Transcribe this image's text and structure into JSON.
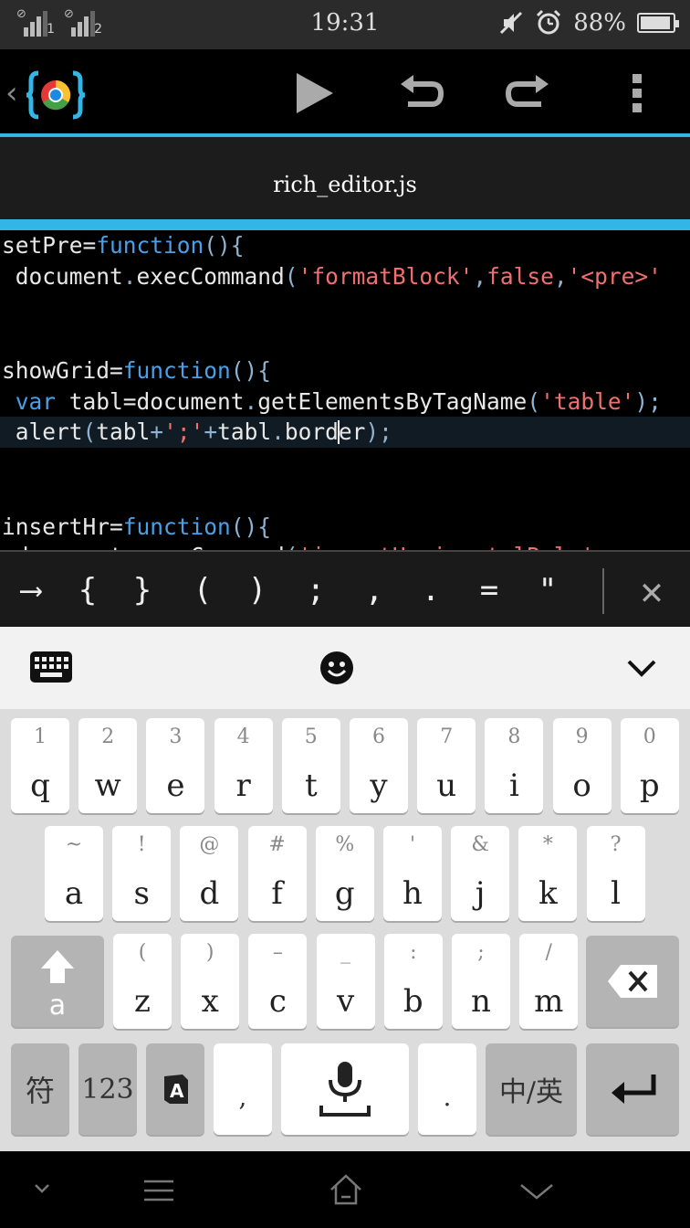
{
  "status_bar": {
    "time": "19:31",
    "battery_percent": "88%",
    "sim1_label": "1",
    "sim2_label": "2",
    "icons": [
      "signal-sim1-icon",
      "signal-sim2-icon",
      "mute-icon",
      "alarm-icon",
      "battery-icon"
    ]
  },
  "toolbar": {
    "back_glyph": "‹",
    "icons": [
      "app-logo-icon",
      "run-icon",
      "undo-icon",
      "redo-icon",
      "overflow-menu-icon"
    ]
  },
  "file_tab": {
    "name": "rich_editor.js"
  },
  "editor": {
    "accent_color": "#33b5e5",
    "lines": [
      {
        "text": "setPre=function(){"
      },
      {
        "text": " document.execCommand('formatBlock',false,'<pre>'"
      },
      {
        "text": ""
      },
      {
        "text": ""
      },
      {
        "text": "showGrid=function(){"
      },
      {
        "text": " var tabl=document.getElementsByTagName('table');"
      },
      {
        "text": " alert(tabl+';'+tabl.border);"
      },
      {
        "text": ""
      },
      {
        "text": ""
      },
      {
        "text": "insertHr=function(){"
      }
    ]
  },
  "symbol_bar": {
    "symbols": [
      "⟶",
      "{",
      "}",
      "(",
      ")",
      ";",
      ",",
      ".",
      "=",
      "\""
    ],
    "close_glyph": "✕"
  },
  "keyboard": {
    "row1": [
      {
        "alt": "1",
        "main": "q"
      },
      {
        "alt": "2",
        "main": "w"
      },
      {
        "alt": "3",
        "main": "e"
      },
      {
        "alt": "4",
        "main": "r"
      },
      {
        "alt": "5",
        "main": "t"
      },
      {
        "alt": "6",
        "main": "y"
      },
      {
        "alt": "7",
        "main": "u"
      },
      {
        "alt": "8",
        "main": "i"
      },
      {
        "alt": "9",
        "main": "o"
      },
      {
        "alt": "0",
        "main": "p"
      }
    ],
    "row2": [
      {
        "alt": "~",
        "main": "a"
      },
      {
        "alt": "!",
        "main": "s"
      },
      {
        "alt": "@",
        "main": "d"
      },
      {
        "alt": "#",
        "main": "f"
      },
      {
        "alt": "%",
        "main": "g"
      },
      {
        "alt": "'",
        "main": "h"
      },
      {
        "alt": "&",
        "main": "j"
      },
      {
        "alt": "*",
        "main": "k"
      },
      {
        "alt": "?",
        "main": "l"
      }
    ],
    "row3": [
      {
        "alt": "(",
        "main": "z"
      },
      {
        "alt": ")",
        "main": "x"
      },
      {
        "alt": "–",
        "main": "c"
      },
      {
        "alt": "_",
        "main": "v"
      },
      {
        "alt": ":",
        "main": "b"
      },
      {
        "alt": ";",
        "main": "n"
      },
      {
        "alt": "/",
        "main": "m"
      }
    ],
    "shift_label": "a",
    "symbols_key": "符",
    "numbers_key": "123",
    "comma_key": ",",
    "period_key": ".",
    "language_key": "中/英"
  }
}
